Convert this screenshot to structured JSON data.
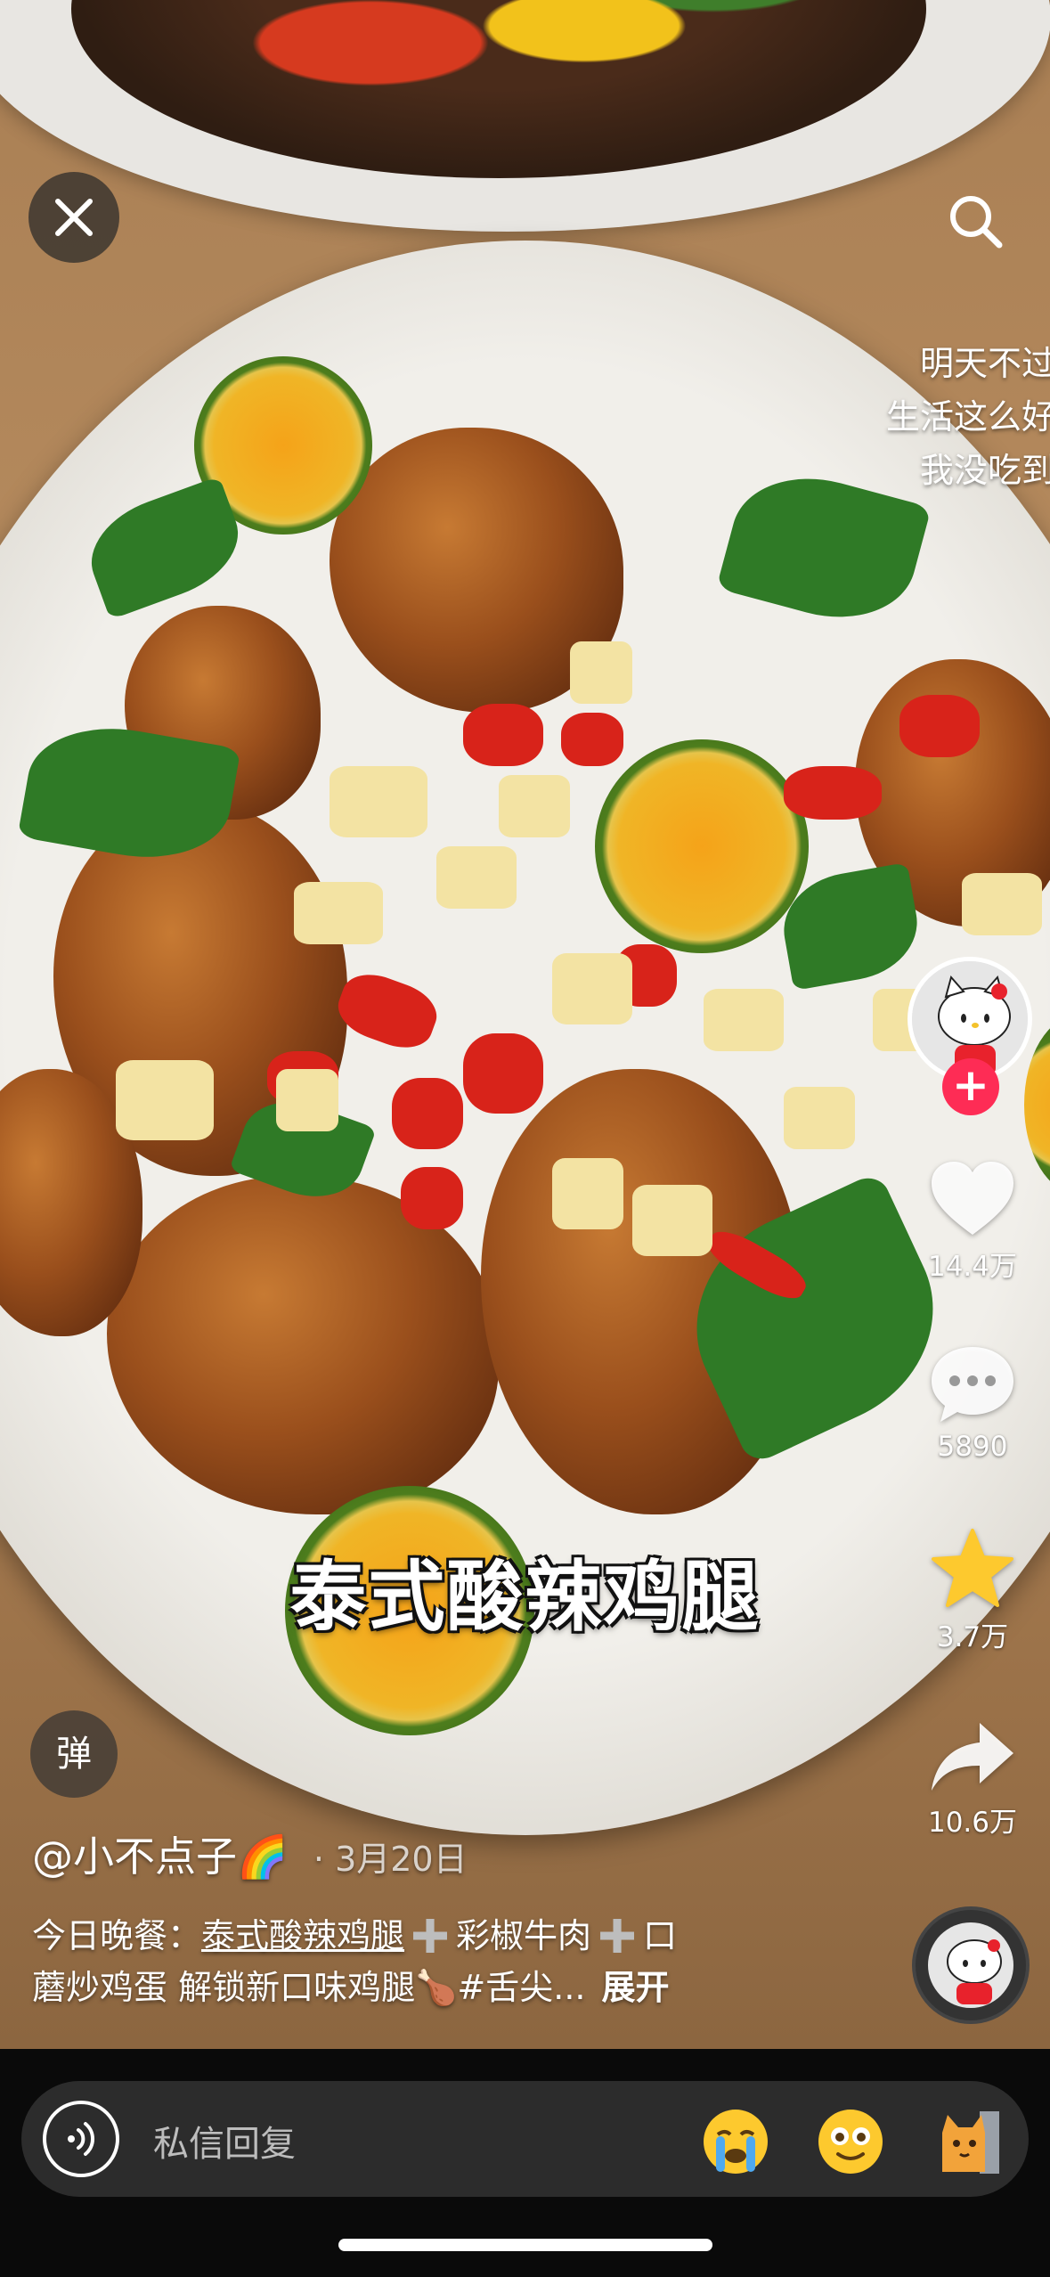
{
  "overlay": {
    "side_lines": [
      "明天不过",
      "生活这么好",
      "我没吃到"
    ],
    "dish_title": "泰式酸辣鸡腿"
  },
  "actions": {
    "likes": "14.4万",
    "comments": "5890",
    "favorites": "3.7万",
    "shares": "10.6万",
    "like_color": "#ffffff",
    "favorite_color": "#fdc92e"
  },
  "danmu_label": "弹",
  "post": {
    "author": "@小不点子🌈",
    "date": "3月20日",
    "desc_prefix": "今日晚餐：",
    "desc_tag": "泰式酸辣鸡腿",
    "desc_mid": "彩椒牛肉",
    "desc_tail_1": "口",
    "desc_line2": "蘑炒鸡蛋 解锁新口味鸡腿🍗#舌尖...",
    "expand": "展开"
  },
  "reply": {
    "placeholder": "私信回复"
  },
  "icons": {
    "close": "close-icon",
    "search": "search-icon",
    "like": "heart-icon",
    "comment": "comment-icon",
    "favorite": "star-icon",
    "share": "share-icon",
    "voice": "voice-icon"
  },
  "colors": {
    "follow_accent": "#fe2c55"
  }
}
